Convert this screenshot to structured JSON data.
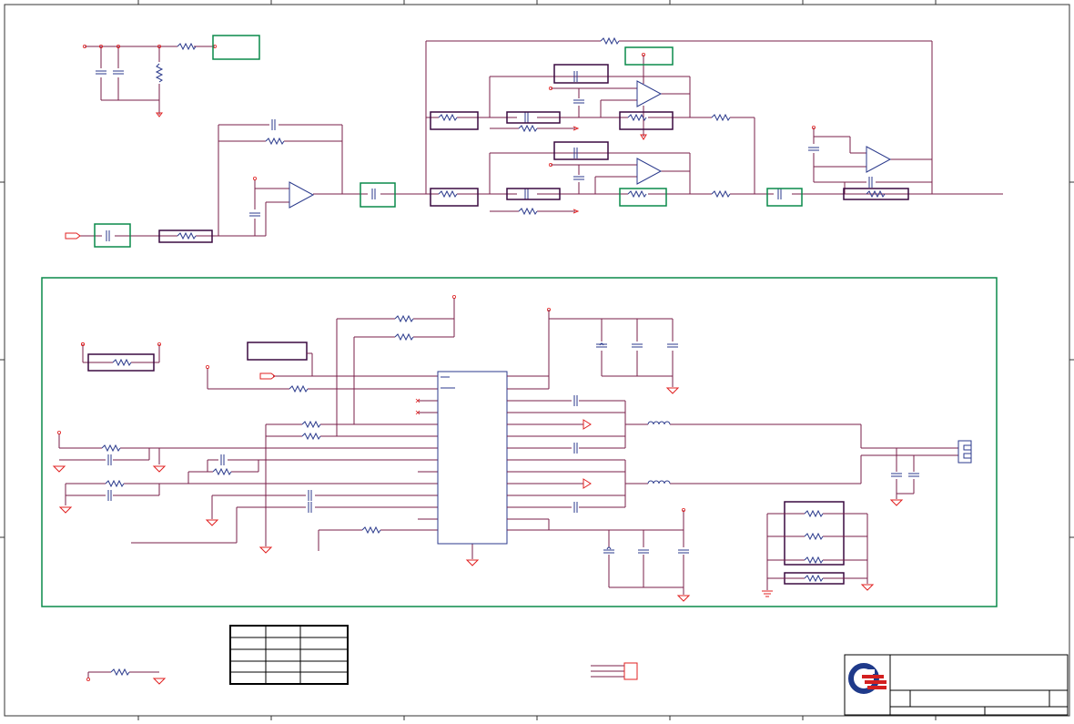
{
  "sheet": {
    "title": "",
    "border_color": "#000000",
    "wire_color": "#7a1f4a",
    "component_color": "#2b3a8c",
    "pin_color": "#e02020",
    "highlight_green": "#0a8a4a",
    "highlight_purple": "#3a0a40"
  },
  "title_block": {
    "logo_icon": "company-logo-icon",
    "title_text": "",
    "sheet_text": ""
  },
  "revision_table": {
    "rows": 4,
    "cols": 3
  },
  "connector": {
    "icon": "connector-icon"
  }
}
